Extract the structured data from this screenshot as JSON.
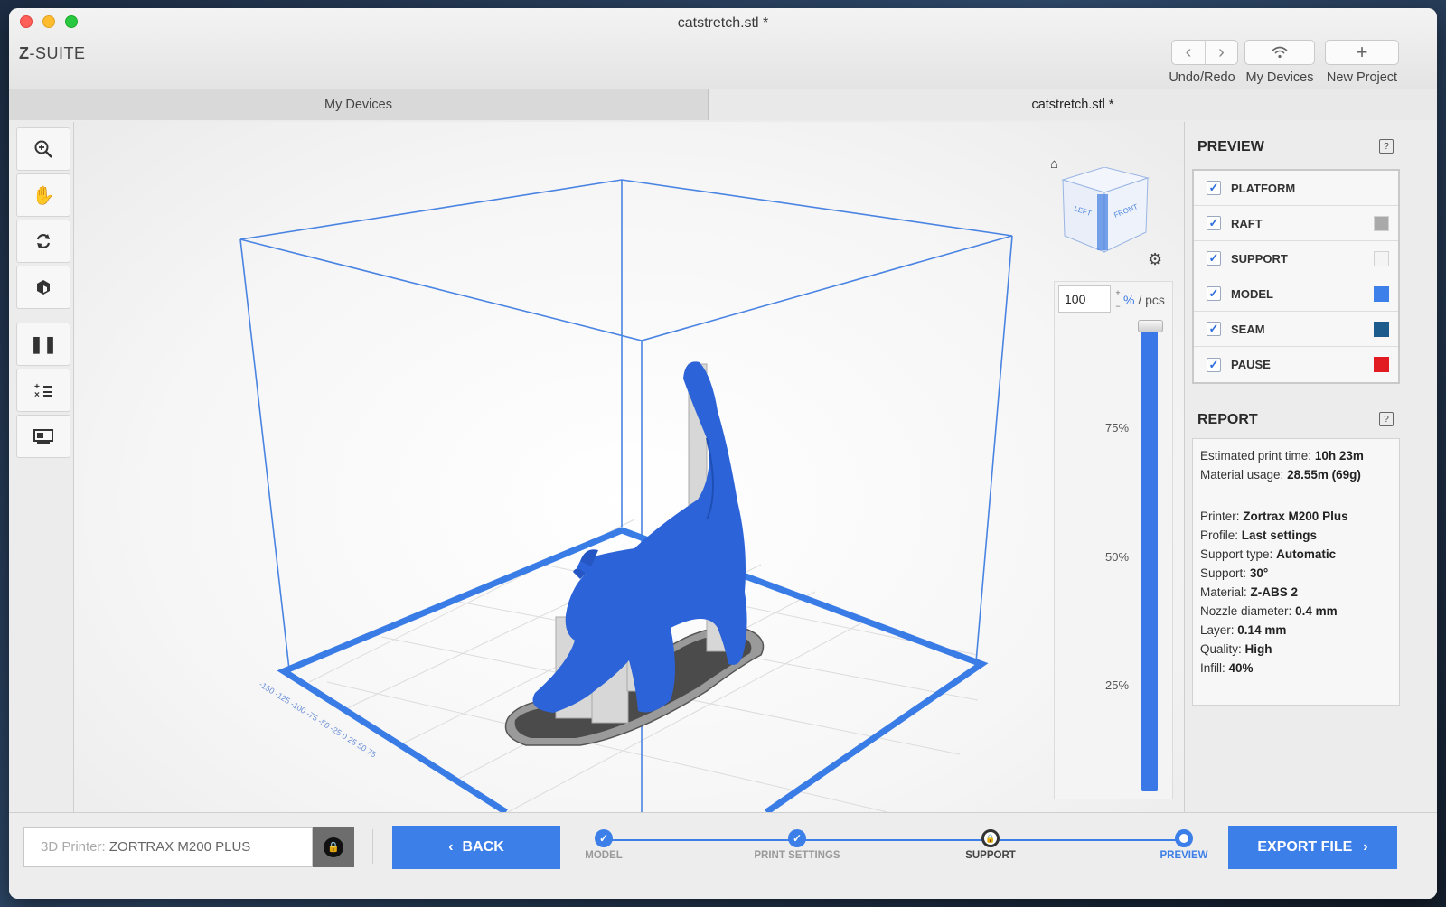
{
  "window": {
    "title": "catstretch.stl *",
    "brand_prefix": "Z",
    "brand_suffix": "-SUITE"
  },
  "toolbar": {
    "undo_redo_label": "Undo/Redo",
    "my_devices_label": "My Devices",
    "new_project_label": "New Project"
  },
  "tabs": [
    {
      "label": "My Devices"
    },
    {
      "label": "catstretch.stl *"
    }
  ],
  "left_tools": [
    {
      "name": "zoom-in-icon",
      "glyph": "⊕"
    },
    {
      "name": "pan-hand-icon",
      "glyph": "✋"
    },
    {
      "name": "rotate-icon",
      "glyph": "⟳"
    },
    {
      "name": "view-cube-icon",
      "glyph": "⬢"
    },
    {
      "name": "pause-icon",
      "glyph": "⏸"
    },
    {
      "name": "calculator-icon",
      "glyph": "±"
    },
    {
      "name": "layout-icon",
      "glyph": "▭"
    }
  ],
  "viewport": {
    "viewcube_left": "LEFT",
    "viewcube_front": "FRONT",
    "layer_value": "100",
    "layer_unit_pct": "%",
    "layer_unit_pcs": " / pcs",
    "layer_level": 1.0,
    "ticks": [
      "75%",
      "50%",
      "25%"
    ]
  },
  "preview": {
    "title": "PREVIEW",
    "items": [
      {
        "label": "PLATFORM",
        "checked": true,
        "color": null
      },
      {
        "label": "RAFT",
        "checked": true,
        "color": "#a9a9a9"
      },
      {
        "label": "SUPPORT",
        "checked": true,
        "color": "#f4f4f4"
      },
      {
        "label": "MODEL",
        "checked": true,
        "color": "#3d80ea"
      },
      {
        "label": "SEAM",
        "checked": true,
        "color": "#1c5c8c"
      },
      {
        "label": "PAUSE",
        "checked": true,
        "color": "#e21b23"
      }
    ]
  },
  "report": {
    "title": "REPORT",
    "print_time_label": "Estimated print time:",
    "print_time": "10h 23m",
    "material_usage_label": "Material usage:",
    "material_usage": "28.55m (69g)",
    "printer_label": "Printer:",
    "printer": "Zortrax M200 Plus",
    "profile_label": "Profile:",
    "profile": "Last settings",
    "support_type_label": "Support type:",
    "support_type": "Automatic",
    "support_label": "Support:",
    "support": "30°",
    "material_label": "Material:",
    "material": "Z-ABS 2",
    "nozzle_label": "Nozzle diameter:",
    "nozzle": "0.4 mm",
    "layer_label": "Layer:",
    "layer": "0.14 mm",
    "quality_label": "Quality:",
    "quality": "High",
    "infill_label": "Infill:",
    "infill": "40%"
  },
  "bottom": {
    "printer_prefix": "3D Printer: ",
    "printer_value": "ZORTRAX M200 PLUS",
    "back_label": "BACK",
    "export_label": "EXPORT FILE",
    "steps": [
      {
        "label": "MODEL",
        "state": "done"
      },
      {
        "label": "PRINT SETTINGS",
        "state": "done"
      },
      {
        "label": "SUPPORT",
        "state": "locked"
      },
      {
        "label": "PREVIEW",
        "state": "current"
      }
    ]
  },
  "colors": {
    "accent": "#3d7fe8",
    "model_blue": "#2a63d6"
  }
}
